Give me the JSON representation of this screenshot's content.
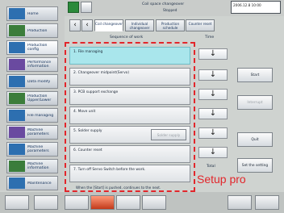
{
  "header": {
    "title": "Coil space changeover",
    "datetime": "2006.12.8 10:00",
    "subtitle": "Stopped"
  },
  "tabs": [
    {
      "label": "Coil changeover"
    },
    {
      "label": "Individual changeover"
    },
    {
      "label": "Production schedule"
    },
    {
      "label": "Counter reset"
    }
  ],
  "sidebar": {
    "items": [
      {
        "label": "Home"
      },
      {
        "label": "Production"
      },
      {
        "label": "Production config"
      },
      {
        "label": "Performance information"
      },
      {
        "label": "Data modify"
      },
      {
        "label": "Production Upper/Lower"
      },
      {
        "label": "File managing"
      },
      {
        "label": "Machine parameters"
      },
      {
        "label": "Machine parameters"
      },
      {
        "label": "Machine information"
      },
      {
        "label": "Maintenance"
      }
    ]
  },
  "panel": {
    "header": "Sequence of work",
    "time_header": "Time",
    "total_label": "Total",
    "steps": [
      {
        "label": "1. File managing"
      },
      {
        "label": "2. Changeover midpoint(Servo)"
      },
      {
        "label": "3. PCB support exchange"
      },
      {
        "label": "4. Move unit"
      },
      {
        "label": "5. Solder supply",
        "button": "Solder supply"
      },
      {
        "label": "6. Counter reset"
      },
      {
        "label": "7. Turn off Servo Switch before the work."
      }
    ],
    "footer": "When the [Start] is pushed, continues to the next."
  },
  "right_buttons": [
    {
      "label": "Start"
    },
    {
      "label": "Interrupt"
    },
    {
      "label": "Quit"
    },
    {
      "label": "Set the setting"
    }
  ],
  "annotation": "Setup pro"
}
